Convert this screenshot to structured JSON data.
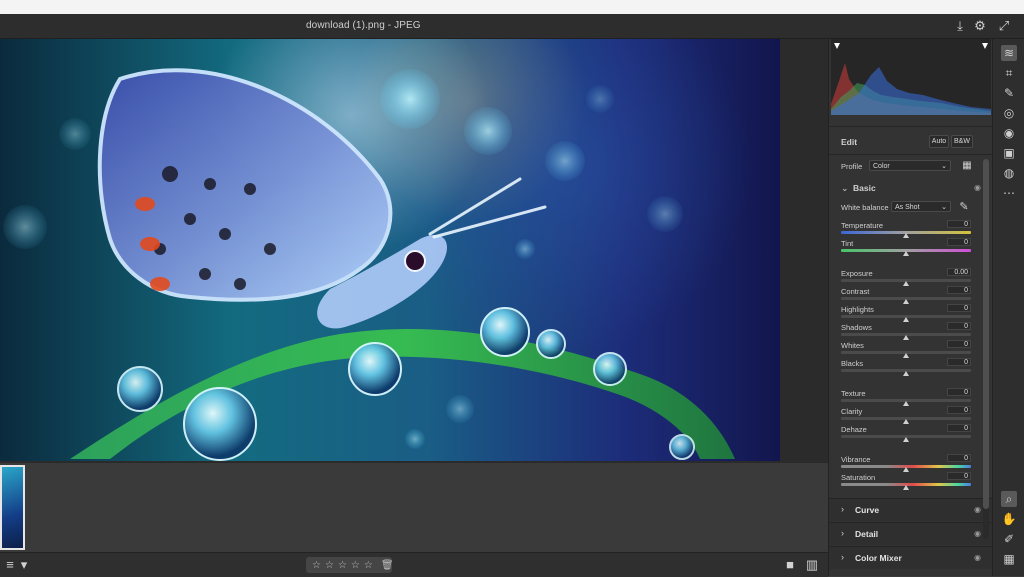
{
  "title_bar": {
    "filename": "download (1).png",
    "separator": "-",
    "filetype": "JPEG"
  },
  "titlebar_icons": [
    "save-icon",
    "gear-icon",
    "expand-icon"
  ],
  "right_panel": {
    "edit": {
      "title": "Edit",
      "auto_label": "Auto",
      "bw_label": "B&W"
    },
    "profile": {
      "label": "Profile",
      "value": "Color"
    },
    "basic": {
      "title": "Basic",
      "white_balance": {
        "label": "White balance",
        "value": "As Shot"
      },
      "sliders": [
        {
          "label": "Temperature",
          "value": "0",
          "level": 0.5,
          "track": "temp"
        },
        {
          "label": "Tint",
          "value": "0",
          "level": 0.5,
          "track": "tint"
        },
        {
          "label": "Exposure",
          "value": "0.00",
          "level": 0.5,
          "track": "gray"
        },
        {
          "label": "Contrast",
          "value": "0",
          "level": 0.5,
          "track": "gray"
        },
        {
          "label": "Highlights",
          "value": "0",
          "level": 0.5,
          "track": "gray"
        },
        {
          "label": "Shadows",
          "value": "0",
          "level": 0.5,
          "track": "gray"
        },
        {
          "label": "Whites",
          "value": "0",
          "level": 0.5,
          "track": "gray"
        },
        {
          "label": "Blacks",
          "value": "0",
          "level": 0.5,
          "track": "gray"
        },
        {
          "label": "Texture",
          "value": "0",
          "level": 0.5,
          "track": "gray"
        },
        {
          "label": "Clarity",
          "value": "0",
          "level": 0.5,
          "track": "gray"
        },
        {
          "label": "Dehaze",
          "value": "0",
          "level": 0.5,
          "track": "gray"
        },
        {
          "label": "Vibrance",
          "value": "0",
          "level": 0.5,
          "track": "vib"
        },
        {
          "label": "Saturation",
          "value": "0",
          "level": 0.5,
          "track": "vib"
        }
      ]
    },
    "sections": [
      {
        "title": "Curve"
      },
      {
        "title": "Detail"
      },
      {
        "title": "Color Mixer"
      }
    ]
  },
  "toolstrip": {
    "top": [
      "edit-sliders-icon",
      "crop-icon",
      "healing-brush-icon",
      "masking-icon",
      "red-eye-icon",
      "snapshots-icon",
      "presets-icon",
      "more-icon"
    ],
    "bottom": [
      "zoom-icon",
      "hand-icon",
      "color-sampler-icon",
      "grid-icon"
    ]
  },
  "rating": {
    "stars": 5,
    "filled": 0
  }
}
